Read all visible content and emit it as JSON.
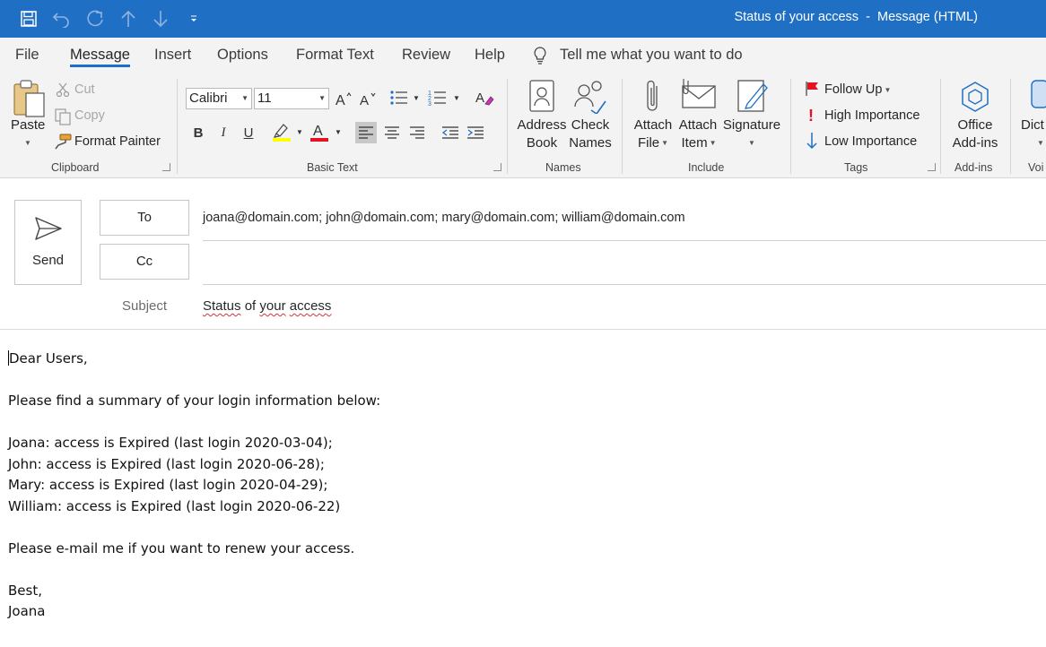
{
  "window": {
    "title": "Status of your access  -  Message (HTML)"
  },
  "qat": {
    "icons": [
      "save-icon",
      "undo-icon",
      "redo-icon",
      "up-arrow-icon",
      "down-arrow-icon",
      "customize-qat-icon"
    ]
  },
  "tabs": [
    {
      "label": "File"
    },
    {
      "label": "Message"
    },
    {
      "label": "Insert"
    },
    {
      "label": "Options"
    },
    {
      "label": "Format Text"
    },
    {
      "label": "Review"
    },
    {
      "label": "Help"
    }
  ],
  "tell_me": "Tell me what you want to do",
  "ribbon": {
    "clipboard": {
      "paste": "Paste",
      "cut": "Cut",
      "copy": "Copy",
      "format_painter": "Format Painter",
      "label": "Clipboard"
    },
    "basic_text": {
      "font": "Calibri",
      "size": "11",
      "label": "Basic Text",
      "bold": "B",
      "italic": "I",
      "underline": "U",
      "highlight_color": "#ffff00",
      "font_color": "#e81123"
    },
    "names": {
      "address_book": [
        "Address",
        "Book"
      ],
      "check_names": [
        "Check",
        "Names"
      ],
      "label": "Names"
    },
    "include": {
      "attach_file": [
        "Attach",
        "File"
      ],
      "attach_item": [
        "Attach",
        "Item"
      ],
      "signature": "Signature",
      "label": "Include"
    },
    "tags": {
      "follow_up": "Follow Up",
      "high_importance": "High Importance",
      "low_importance": "Low Importance",
      "label": "Tags"
    },
    "addins": {
      "office_addins": [
        "Office",
        "Add-ins"
      ],
      "label": "Add-ins"
    },
    "voice": {
      "dictate": "Dict",
      "label": "Voi"
    }
  },
  "compose": {
    "send": "Send",
    "to_label": "To",
    "to_value": "joana@domain.com; john@domain.com; mary@domain.com; william@domain.com",
    "cc_label": "Cc",
    "cc_value": "",
    "subject_label": "Subject",
    "subject_words": [
      "Status",
      "of",
      "your",
      "access"
    ]
  },
  "body": {
    "greeting": "Dear Users,",
    "intro": "Please find a summary of your login information below:",
    "lines": [
      "Joana: access is Expired (last login 2020-03-04);",
      "John: access is Expired (last login 2020-06-28);",
      "Mary: access is Expired (last login 2020-04-29);",
      "William: access is Expired (last login 2020-06-22)"
    ],
    "closing": "Please e-mail me if you want to renew your access.",
    "signoff": "Best,",
    "signature": "Joana"
  },
  "colors": {
    "title_bar": "#1f6fc5",
    "ribbon_bg": "#f3f3f3",
    "accent": "#1f6fc5",
    "flag": "#e81123",
    "high_importance": "#e81123",
    "low_importance": "#1f6fc5"
  }
}
